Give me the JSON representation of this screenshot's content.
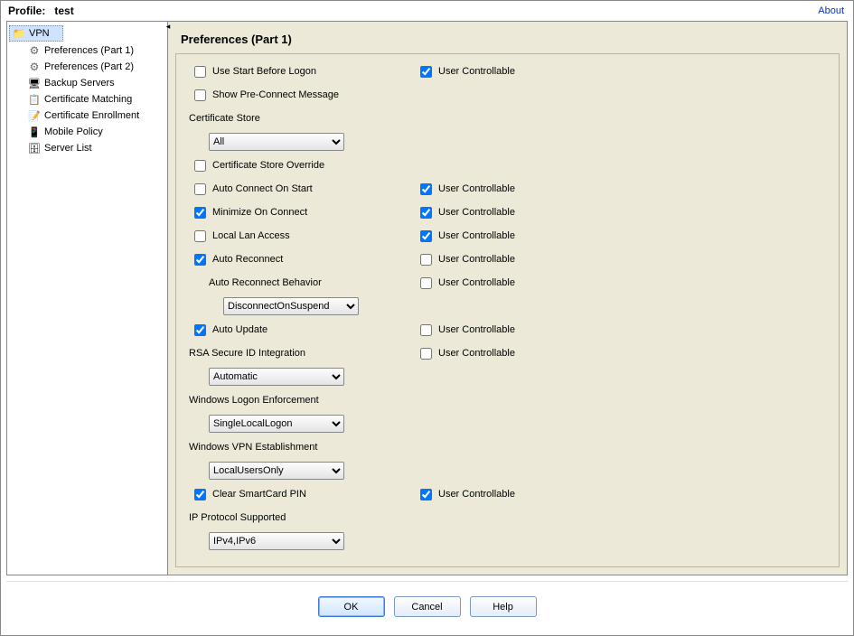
{
  "header": {
    "profile_prefix": "Profile:",
    "profile_name": "test",
    "about": "About"
  },
  "sidebar": {
    "root": "VPN",
    "items": [
      {
        "label": "Preferences (Part 1)",
        "icon": "gear"
      },
      {
        "label": "Preferences (Part 2)",
        "icon": "gear"
      },
      {
        "label": "Backup Servers",
        "icon": "server"
      },
      {
        "label": "Certificate Matching",
        "icon": "cert"
      },
      {
        "label": "Certificate Enrollment",
        "icon": "enroll"
      },
      {
        "label": "Mobile Policy",
        "icon": "mobile"
      },
      {
        "label": "Server List",
        "icon": "list"
      }
    ]
  },
  "content": {
    "title": "Preferences (Part 1)",
    "uc_label": "User Controllable",
    "rows": {
      "use_start_before_logon": {
        "label": "Use Start Before Logon",
        "checked": false,
        "uc_checked": true
      },
      "show_pre_connect": {
        "label": "Show Pre-Connect Message",
        "checked": false
      },
      "cert_store_label": "Certificate Store",
      "cert_store_value": "All",
      "cert_store_override": {
        "label": "Certificate Store Override",
        "checked": false
      },
      "auto_connect": {
        "label": "Auto Connect On Start",
        "checked": false,
        "uc_checked": true
      },
      "minimize": {
        "label": "Minimize On Connect",
        "checked": true,
        "uc_checked": true
      },
      "local_lan": {
        "label": "Local Lan Access",
        "checked": false,
        "uc_checked": true
      },
      "auto_reconnect": {
        "label": "Auto Reconnect",
        "checked": true,
        "uc_checked": false
      },
      "auto_reconnect_behavior_label": "Auto Reconnect Behavior",
      "auto_reconnect_behavior_value": "DisconnectOnSuspend",
      "auto_reconnect_behavior_uc": false,
      "auto_update": {
        "label": "Auto Update",
        "checked": true,
        "uc_checked": false
      },
      "rsa_label": "RSA Secure ID Integration",
      "rsa_value": "Automatic",
      "rsa_uc": false,
      "win_logon_label": "Windows Logon Enforcement",
      "win_logon_value": "SingleLocalLogon",
      "win_vpn_label": "Windows VPN Establishment",
      "win_vpn_value": "LocalUsersOnly",
      "clear_smartcard": {
        "label": "Clear SmartCard PIN",
        "checked": true,
        "uc_checked": true
      },
      "ip_proto_label": "IP Protocol Supported",
      "ip_proto_value": "IPv4,IPv6"
    }
  },
  "footer": {
    "ok": "OK",
    "cancel": "Cancel",
    "help": "Help"
  }
}
